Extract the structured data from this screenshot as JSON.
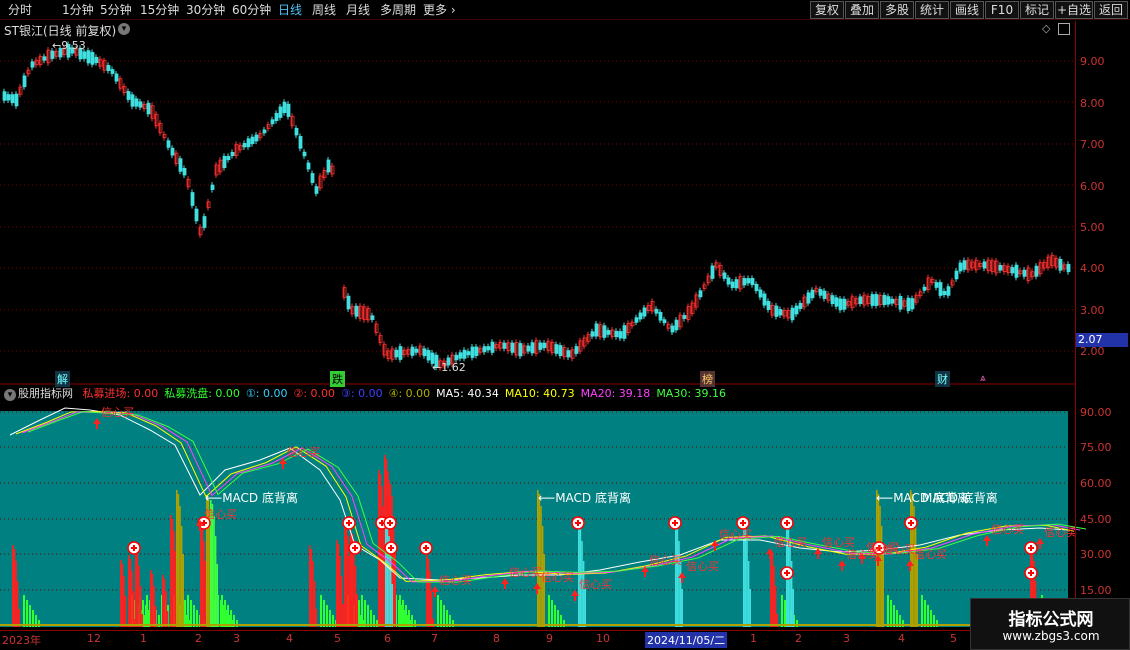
{
  "toolbar": {
    "tabs": [
      "分时",
      "1分钟",
      "5分钟",
      "15分钟",
      "30分钟",
      "60分钟",
      "日线",
      "周线",
      "月线",
      "多周期",
      "更多"
    ],
    "active_tab": "日线",
    "right_buttons": [
      "复权",
      "叠加",
      "多股",
      "统计",
      "画线",
      "F10",
      "标记",
      "+自选",
      "返回"
    ]
  },
  "main_chart": {
    "title": "ST银江(日线 前复权)",
    "high_label": "9.53",
    "low_label": "1.62",
    "price_label": "2.07",
    "y_ticks": [
      "9.00",
      "8.00",
      "7.00",
      "6.00",
      "5.00",
      "4.00",
      "3.00",
      "2.00"
    ],
    "markers": [
      "解",
      "跌",
      "榜",
      "财"
    ]
  },
  "indicator": {
    "name": "股朋指标网",
    "values": [
      {
        "label": "私募进场:",
        "value": "0.00",
        "color": "#ff3030"
      },
      {
        "label": "私募洗盘:",
        "value": "0.00",
        "color": "#30ff30"
      },
      {
        "label": "①:",
        "value": "0.00",
        "color": "#30d0ff"
      },
      {
        "label": "②:",
        "value": "0.00",
        "color": "#ff3030"
      },
      {
        "label": "③:",
        "value": "0.00",
        "color": "#4040ff"
      },
      {
        "label": "④:",
        "value": "0.00",
        "color": "#b0b000"
      },
      {
        "label": "MA5:",
        "value": "40.34",
        "color": "#ffffff"
      },
      {
        "label": "MA10:",
        "value": "40.73",
        "color": "#ffff00"
      },
      {
        "label": "MA20:",
        "value": "39.18",
        "color": "#ff40ff"
      },
      {
        "label": "MA30:",
        "value": "39.16",
        "color": "#40ff40"
      }
    ],
    "y_ticks": [
      "90.00",
      "75.00",
      "60.00",
      "45.00",
      "30.00",
      "15.00"
    ],
    "annotations": [
      "MACD 底背离",
      "MACD 底背离",
      "MACD 底背离",
      "MACD 底背离"
    ],
    "buy_label": "信心买"
  },
  "x_axis": {
    "labels": [
      "2023年",
      "12",
      "1",
      "2",
      "3",
      "4",
      "5",
      "6",
      "7",
      "8",
      "9",
      "10",
      "2024/11/05/二",
      "1",
      "2",
      "3",
      "4",
      "5"
    ]
  },
  "watermark": {
    "title": "指标公式网",
    "url": "www.zbgs3.com"
  },
  "colors": {
    "bg": "#000000",
    "panel": "#008080",
    "grid": "#8b0000",
    "up": "#ff3030",
    "down": "#40e0e0"
  }
}
